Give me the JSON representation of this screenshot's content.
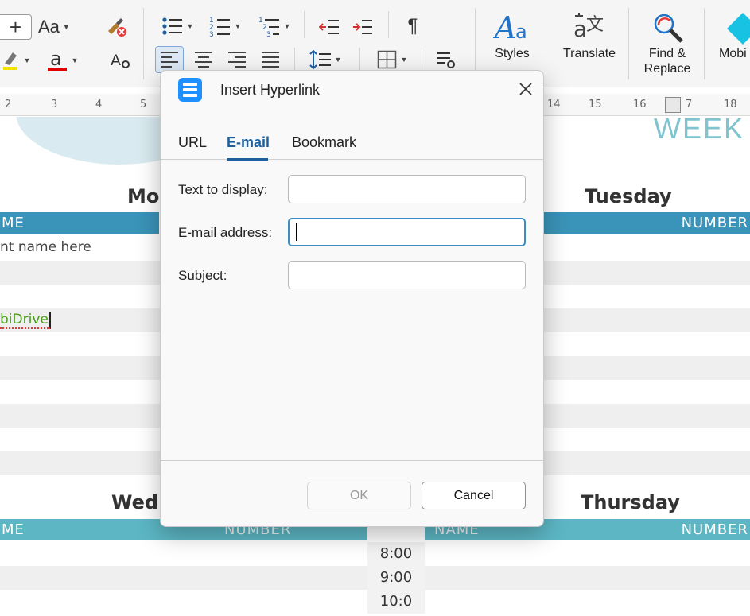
{
  "ribbon": {
    "font_case_label": "Aa",
    "big_buttons": {
      "styles": "Styles",
      "translate": "Translate",
      "find_replace": "Find &\nReplace",
      "mobidrive": "Mobi"
    }
  },
  "ruler": {
    "marks": [
      "2",
      "3",
      "4",
      "5",
      "14",
      "15",
      "16",
      "7",
      "18"
    ]
  },
  "document": {
    "banner_text": "WEEK",
    "days": {
      "monday": "Mo",
      "tuesday": "Tuesday",
      "wednesday": "Wedn",
      "thursday": "Thursday"
    },
    "headers": {
      "name_left": "ME",
      "number_right": "NUMBER",
      "name_left_bottom": "ME",
      "number_mid_bottom": "NUMBER",
      "name_mid_bottom": "NAME",
      "number_right_bottom": "NUMBER"
    },
    "cells": {
      "client_placeholder": "nt name here",
      "link_text": "biDrive"
    },
    "times": [
      "8:00",
      "9:00",
      "10:0"
    ]
  },
  "dialog": {
    "title": "Insert Hyperlink",
    "tabs": [
      {
        "label": "URL"
      },
      {
        "label": "E-mail"
      },
      {
        "label": "Bookmark"
      }
    ],
    "active_tab": "E-mail",
    "fields": {
      "text_to_display": {
        "label": "Text to display:",
        "value": ""
      },
      "email_address": {
        "label": "E-mail address:",
        "value": ""
      },
      "subject": {
        "label": "Subject:",
        "value": ""
      }
    },
    "buttons": {
      "ok": "OK",
      "cancel": "Cancel"
    }
  },
  "colors": {
    "accent_blue": "#1f5f9e",
    "header_teal": "#3a93b8",
    "header_teal_light": "#5cb6c4",
    "icon_blue": "#1e90ff"
  }
}
